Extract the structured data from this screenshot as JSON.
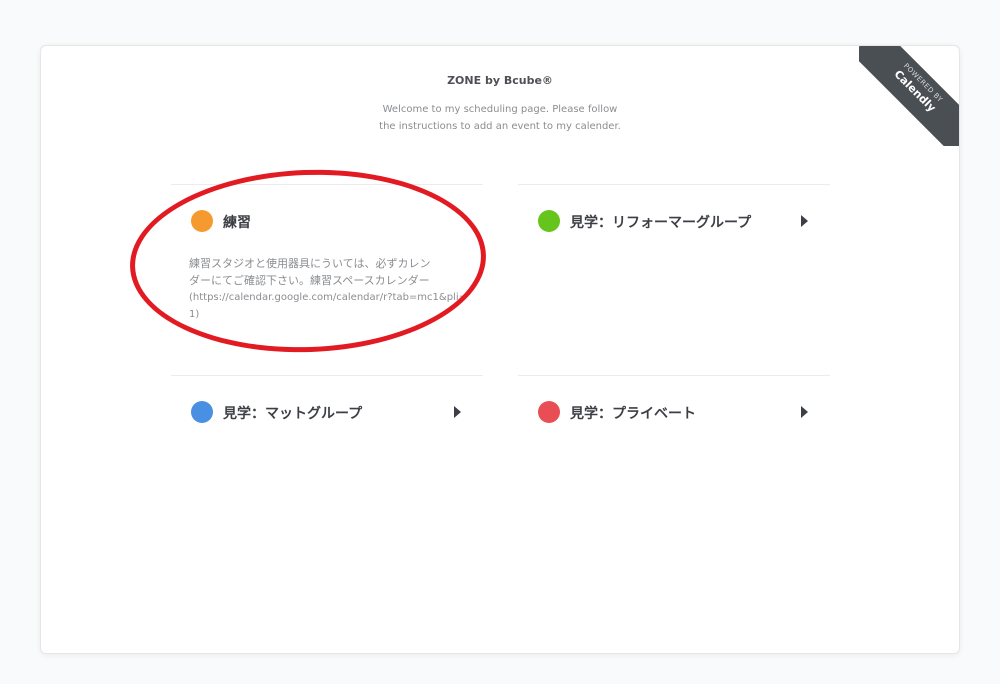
{
  "header": {
    "title": "ZONE by Bcube®",
    "welcome": "Welcome to my scheduling page. Please follow the instructions to add an event to my calender."
  },
  "ribbon": {
    "powered": "POWERED BY",
    "brand": "Calendly"
  },
  "events": [
    {
      "name": "練習",
      "color": "#f59a2f",
      "desc_line1": "練習スタジオと使用器具にういては、必ずカレン",
      "desc_line2": "ダーにてご確認下さい。練習スペースカレンダー",
      "desc_url": "(https://calendar.google.com/calendar/r?tab=mc1&pli=1)"
    },
    {
      "name": "見学：リフォーマーグループ",
      "color": "#66c51c"
    },
    {
      "name": "見学：マットグループ",
      "color": "#4a90e2"
    },
    {
      "name": "見学：プライベート",
      "color": "#e84e53"
    }
  ],
  "colors": {
    "annotation": "#e21b23",
    "ribbon": "#4a4f54"
  }
}
